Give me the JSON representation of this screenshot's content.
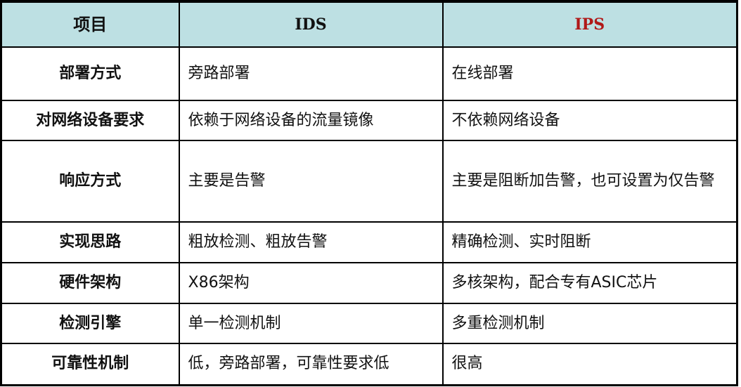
{
  "header": {
    "item": "项目",
    "ids": "IDS",
    "ips": "IPS"
  },
  "colors": {
    "header_bg": "#bde0e3",
    "ips_header": "#b01818"
  },
  "rows": [
    {
      "item": "部署方式",
      "ids": "旁路部署",
      "ips": "在线部署"
    },
    {
      "item": "对网络设备要求",
      "ids": "依赖于网络设备的流量镜像",
      "ips": "不依赖网络设备"
    },
    {
      "item": "响应方式",
      "ids": "主要是告警",
      "ips": "主要是阻断加告警，也可设置为仅告警"
    },
    {
      "item": "实现思路",
      "ids": "粗放检测、粗放告警",
      "ips": "精确检测、实时阻断"
    },
    {
      "item": "硬件架构",
      "ids": "X86架构",
      "ips": "多核架构，配合专有ASIC芯片"
    },
    {
      "item": "检测引擎",
      "ids": "单一检测机制",
      "ips": "多重检测机制"
    },
    {
      "item": "可靠性机制",
      "ids": "低，旁路部署，可靠性要求低",
      "ips": "很高"
    }
  ]
}
